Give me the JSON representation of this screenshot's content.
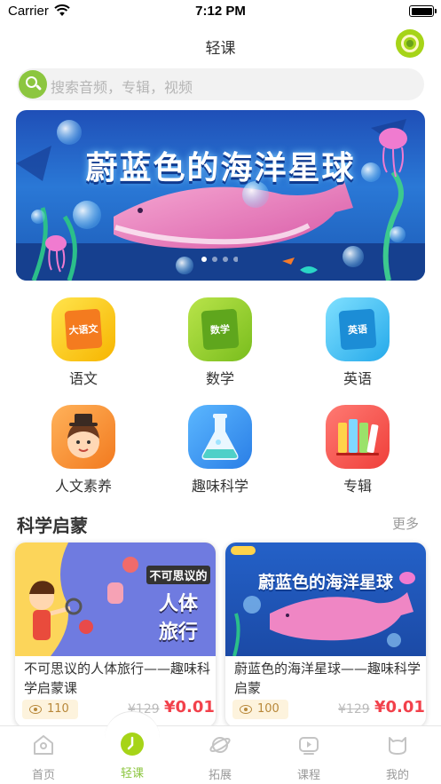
{
  "status_bar": {
    "carrier": "Carrier",
    "time": "7:12 PM"
  },
  "nav": {
    "title": "轻课"
  },
  "search": {
    "placeholder": "搜索音频，专辑，视频"
  },
  "banner": {
    "title": "蔚蓝色的海洋星球"
  },
  "categories": [
    {
      "label": "语文",
      "badge": "大语文",
      "icon": "chinese-book-icon"
    },
    {
      "label": "数学",
      "badge": "数学",
      "icon": "math-book-icon"
    },
    {
      "label": "英语",
      "badge": "英语",
      "icon": "english-book-icon"
    },
    {
      "label": "人文素养",
      "icon": "boy-face-icon"
    },
    {
      "label": "趣味科学",
      "icon": "flask-icon"
    },
    {
      "label": "专辑",
      "icon": "books-icon"
    }
  ],
  "section": {
    "title": "科学启蒙",
    "more": "更多"
  },
  "cards": [
    {
      "image_text_1": "不可思议的",
      "image_text_2": "人体",
      "image_text_3": "旅行",
      "title": "不可思议的人体旅行——趣味科学启蒙课",
      "views": "110",
      "old_price": "¥129",
      "price": "¥0.01"
    },
    {
      "image_text_1": "蔚蓝色的海洋星球",
      "title": "蔚蓝色的海洋星球——趣味科学启蒙",
      "views": "100",
      "old_price": "¥129",
      "price": "¥0.01"
    }
  ],
  "tabs": [
    {
      "label": "首页",
      "icon": "home-icon"
    },
    {
      "label": "轻课",
      "icon": "lesson-icon"
    },
    {
      "label": "拓展",
      "icon": "planet-icon"
    },
    {
      "label": "课程",
      "icon": "video-icon"
    },
    {
      "label": "我的",
      "icon": "profile-icon"
    }
  ],
  "colors": {
    "accent": "#8cc63f",
    "price": "#f2414b"
  }
}
